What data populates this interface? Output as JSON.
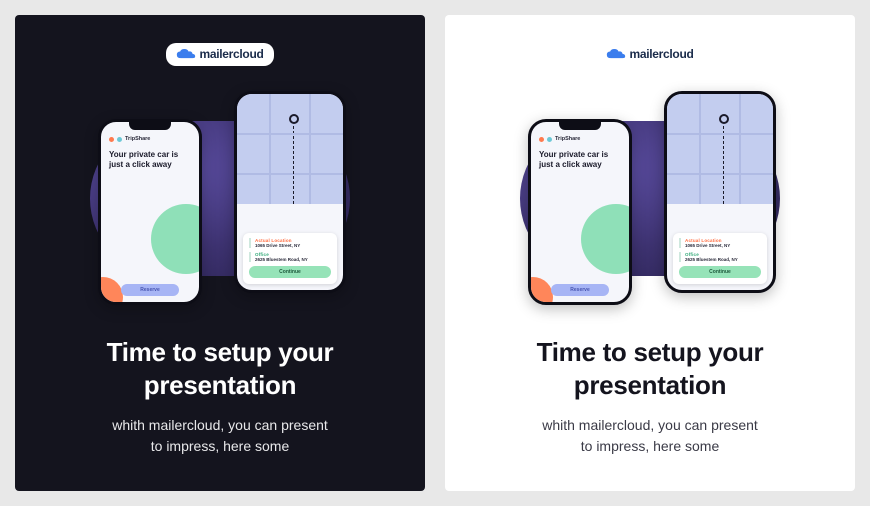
{
  "logo": {
    "text": "mailercloud"
  },
  "phoneLeft": {
    "brand": "TripShare",
    "headline": "Your private car is just a click away",
    "reserveLabel": "Reserve"
  },
  "phoneRight": {
    "locA": {
      "label": "Actual Location",
      "addr": "1065 Drive Street, NY"
    },
    "locB": {
      "label": "Office",
      "addr": "2625 Bluestem Road, NY"
    },
    "continueLabel": "Continue"
  },
  "copy": {
    "headline_l1": "Time to setup your",
    "headline_l2": "presentation",
    "sub_l1": "whith mailercloud, you can present",
    "sub_l2": "to impress, here some"
  },
  "colors": {
    "darkBg": "#14141e",
    "lightBg": "#ffffff",
    "blobA": "#5d4fa5",
    "blobB": "#2a2352",
    "green": "#8fe0b8",
    "orange": "#ff865a",
    "mapBg": "#c3cdef"
  }
}
